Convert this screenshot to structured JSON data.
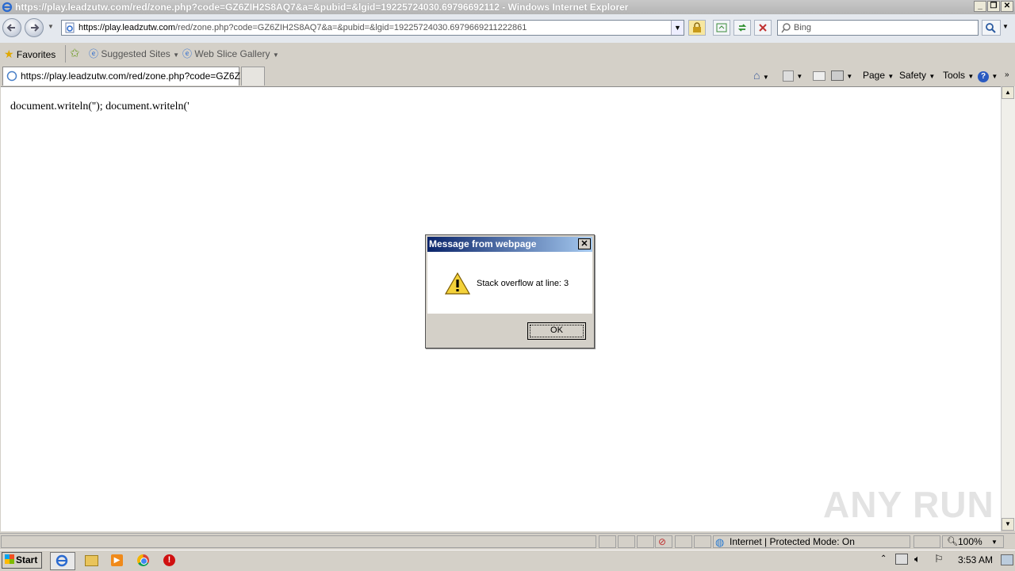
{
  "window": {
    "title": "https://play.leadzutw.com/red/zone.php?code=GZ6ZIH2S8AQ7&a=&pubid=&lgid=19225724030.69796692112 - Windows Internet Explorer"
  },
  "address_bar": {
    "url_host": "https://play.leadzutw.com",
    "url_path": "/red/zone.php?code=GZ6ZIH2S8AQ7&a=&pubid=&lgid=19225724030.6979669211222861"
  },
  "search": {
    "placeholder": "Bing"
  },
  "favorites_bar": {
    "favorites_label": "Favorites",
    "suggested_sites": "Suggested Sites",
    "web_slice_gallery": "Web Slice Gallery"
  },
  "tabs": [
    {
      "label": "https://play.leadzutw.com/red/zone.php?code=GZ6Z..."
    }
  ],
  "command_bar": {
    "page": "Page",
    "safety": "Safety",
    "tools": "Tools"
  },
  "page": {
    "text": "document.writeln(''); document.writeln('"
  },
  "dialog": {
    "title": "Message from webpage",
    "message": "Stack overflow at line: 3",
    "ok": "OK"
  },
  "watermark": "ANY RUN",
  "status_bar": {
    "zone": "Internet | Protected Mode: On",
    "zoom": "100%"
  },
  "taskbar": {
    "start": "Start",
    "clock": "3:53 AM"
  }
}
